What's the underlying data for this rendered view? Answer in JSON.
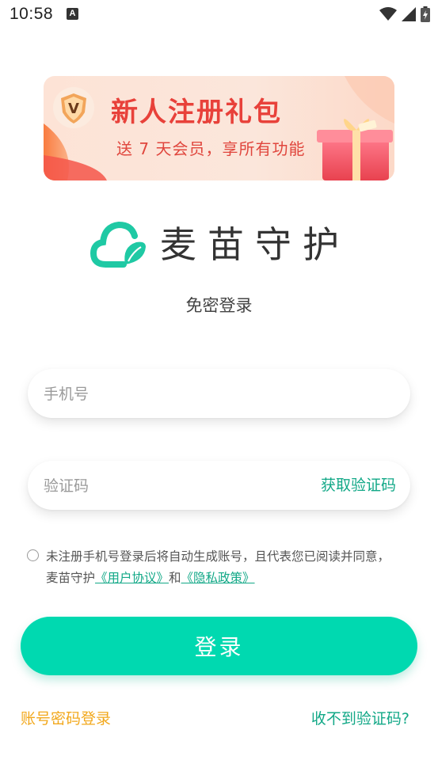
{
  "status_bar": {
    "time": "10:58",
    "notification_icon": "A"
  },
  "banner": {
    "title": "新人注册礼包",
    "subtitle": "送 7 天会员，享所有功能",
    "badge": "V"
  },
  "logo": {
    "name": "麦苗守护"
  },
  "login": {
    "subtitle": "免密登录",
    "phone_placeholder": "手机号",
    "code_placeholder": "验证码",
    "get_code_label": "获取验证码",
    "agreement_prefix": "未注册手机号登录后将自动生成账号，且代表您已阅读并同意，麦苗守护",
    "user_agreement": "《用户协议》",
    "conjunction": "和",
    "privacy_policy": "《隐私政策》",
    "login_button": "登录",
    "password_login": "账号密码登录",
    "no_code": "收不到验证码?"
  },
  "colors": {
    "accent": "#00d9b0",
    "link": "#12a887",
    "orange": "#f2a81c",
    "banner_red": "#e8413a"
  }
}
